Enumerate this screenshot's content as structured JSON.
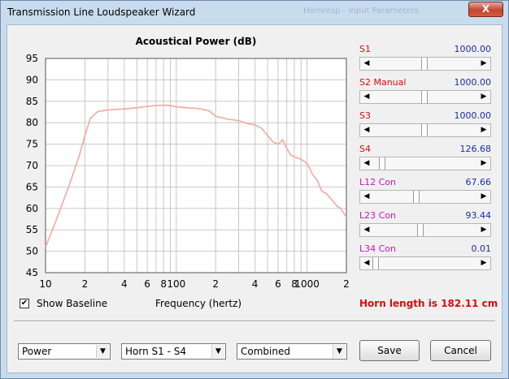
{
  "window": {
    "title": "Transmission Line Loudspeaker Wizard",
    "ghost_text": "Hornresp - Input Parameters",
    "close_glyph": "X"
  },
  "chart_data": {
    "type": "line",
    "title": "Acoustical Power (dB)",
    "xlabel": "Frequency (hertz)",
    "ylabel": "",
    "xscale": "log",
    "xlim": [
      10,
      2000
    ],
    "ylim": [
      45,
      95
    ],
    "yticks": [
      95,
      90,
      85,
      80,
      75,
      70,
      65,
      60,
      55,
      50,
      45
    ],
    "xtick_labels": [
      {
        "x": 10,
        "label": "10"
      },
      {
        "x": 20,
        "label": "2"
      },
      {
        "x": 40,
        "label": "4"
      },
      {
        "x": 60,
        "label": "6"
      },
      {
        "x": 80,
        "label": "8"
      },
      {
        "x": 100,
        "label": "100"
      },
      {
        "x": 200,
        "label": "2"
      },
      {
        "x": 400,
        "label": "4"
      },
      {
        "x": 600,
        "label": "6"
      },
      {
        "x": 800,
        "label": "8"
      },
      {
        "x": 1000,
        "label": "1000"
      },
      {
        "x": 2000,
        "label": "2"
      }
    ],
    "grid": true,
    "series": [
      {
        "color": "#f4a8a0",
        "x": [
          10,
          12,
          15,
          18,
          20,
          22,
          25,
          30,
          40,
          50,
          60,
          70,
          80,
          90,
          100,
          120,
          150,
          180,
          200,
          250,
          300,
          350,
          400,
          450,
          500,
          550,
          600,
          620,
          650,
          700,
          750,
          800,
          900,
          1000,
          1100,
          1200,
          1300,
          1400,
          1500,
          1600,
          1700,
          1800,
          2000
        ],
        "y": [
          51,
          57,
          65,
          72,
          77,
          81,
          82.6,
          83,
          83.2,
          83.5,
          83.8,
          84,
          84.1,
          84,
          83.7,
          83.5,
          83.3,
          82.7,
          81.5,
          80.8,
          80.5,
          79.8,
          79.5,
          78.7,
          77,
          75.5,
          75,
          75.3,
          76,
          74,
          72.5,
          72,
          71.5,
          70.5,
          68,
          66.5,
          64,
          63.5,
          62.5,
          61.5,
          60.5,
          60.1,
          58
        ]
      }
    ]
  },
  "sliders": [
    {
      "label": "S1",
      "value": "1000.00",
      "color": "#d10f0f",
      "pos": 0.5
    },
    {
      "label": "S2  Manual",
      "value": "1000.00",
      "color": "#d10f0f",
      "pos": 0.5
    },
    {
      "label": "S3",
      "value": "1000.00",
      "color": "#d10f0f",
      "pos": 0.5
    },
    {
      "label": "S4",
      "value": "126.68",
      "color": "#d10f0f",
      "pos": 0.07
    },
    {
      "label": "L12  Con",
      "value": "67.66",
      "color": "#c21bb7",
      "pos": 0.42
    },
    {
      "label": "L23  Con",
      "value": "93.44",
      "color": "#c21bb7",
      "pos": 0.46
    },
    {
      "label": "L34  Con",
      "value": "0.01",
      "color": "#c21bb7",
      "pos": 0.0
    }
  ],
  "baseline": {
    "label": "Show Baseline",
    "checked": true,
    "check_glyph": "✔"
  },
  "horn_length": "Horn length is 182.11 cm",
  "dropdowns": [
    {
      "value": "Power"
    },
    {
      "value": "Horn S1 - S4"
    },
    {
      "value": "Combined"
    }
  ],
  "buttons": {
    "save": "Save",
    "cancel": "Cancel"
  }
}
